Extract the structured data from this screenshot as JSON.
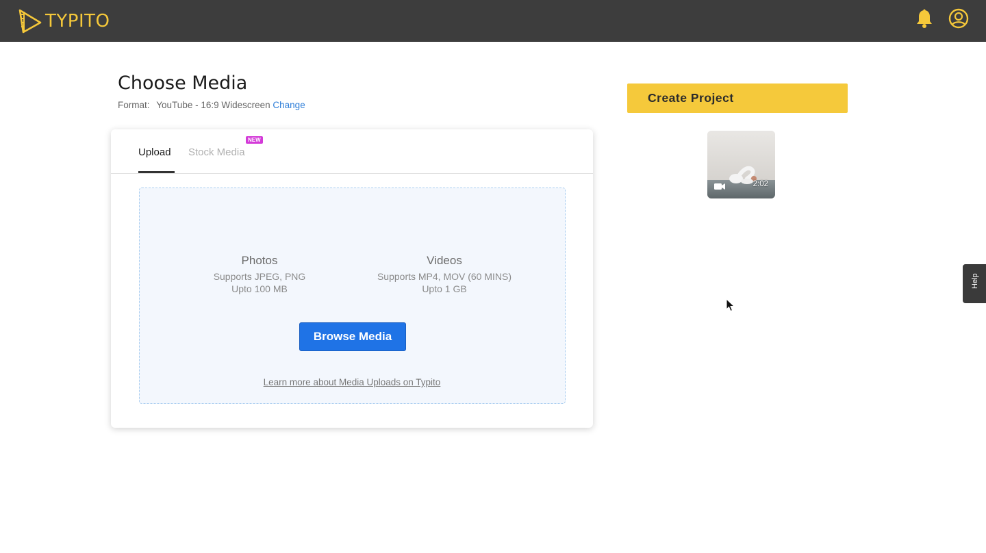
{
  "header": {
    "logo_text": "TYPITO",
    "icons": [
      "notification-bell-icon",
      "user-account-icon"
    ],
    "brand_color": "#f5c83a",
    "bar_color": "#3d3d3d"
  },
  "main": {
    "title": "Choose Media",
    "format_label": "Format:",
    "format_value": "YouTube - 16:9 Widescreen",
    "change_link": "Change"
  },
  "media_panel": {
    "tabs": [
      {
        "label": "Upload",
        "active": true
      },
      {
        "label": "Stock Media",
        "active": false,
        "badge": "NEW"
      }
    ],
    "photos": {
      "title": "Photos",
      "line1": "Supports JPEG, PNG",
      "line2": "Upto 100 MB"
    },
    "videos": {
      "title": "Videos",
      "line1": "Supports MP4, MOV (60 MINS)",
      "line2": "Upto 1 GB"
    },
    "browse_button": "Browse Media",
    "learn_more_link": "Learn more about Media Uploads on Typito",
    "button_color": "#1f73e6"
  },
  "sidebar": {
    "create_button": "Create Project",
    "create_button_color": "#f5c93b",
    "media_items": [
      {
        "type": "video",
        "duration": "2:02",
        "icon": "video-camera-icon"
      }
    ]
  },
  "help_tab": {
    "label": "Help"
  }
}
